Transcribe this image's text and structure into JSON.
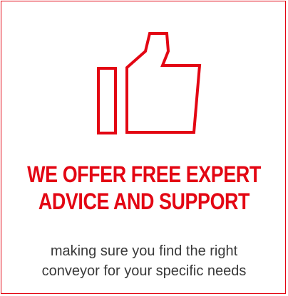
{
  "icon": "thumbs-up-icon",
  "accent_color": "#e30613",
  "headline": {
    "line1": "WE OFFER FREE EXPERT",
    "line2": "ADVICE AND SUPPORT"
  },
  "subtext": {
    "line1": "making sure you find the right",
    "line2": "conveyor for your specific needs"
  }
}
